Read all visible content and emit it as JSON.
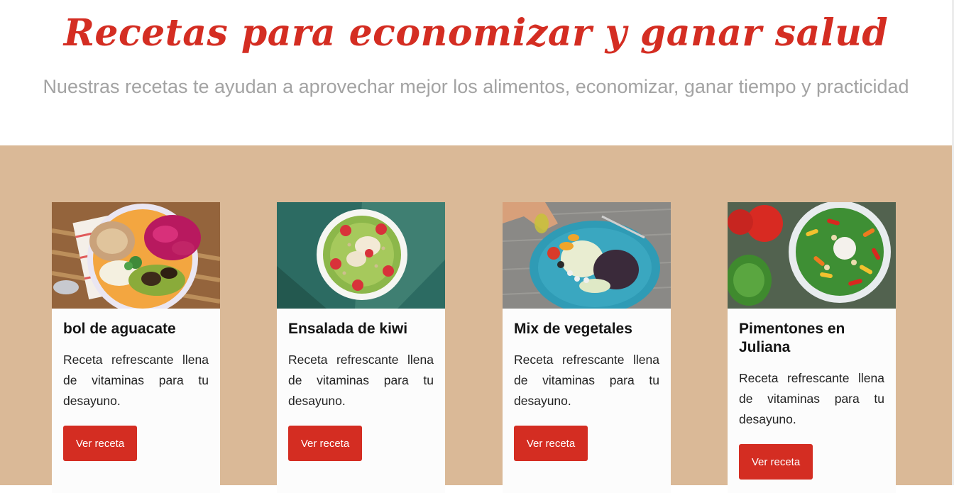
{
  "hero": {
    "title": "Recetas para economizar y ganar salud",
    "subtitle": "Nuestras recetas te ayudan a aprovechar mejor los alimentos, economizar, ganar tiempo y practicidad"
  },
  "colors": {
    "accent": "#d42d22",
    "section_background": "#dab997",
    "card_background": "#fcfcfc",
    "subtitle_gray": "#a3a3a3"
  },
  "cards": [
    {
      "title": "bol de aguacate",
      "description": "Receta refrescante llena de vitaminas para tu desayuno.",
      "button_label": "Ver receta"
    },
    {
      "title": "Ensalada de kiwi",
      "description": "Receta refrescante llena de vitaminas para tu desayuno.",
      "button_label": "Ver receta"
    },
    {
      "title": "Mix de vegetales",
      "description": "Receta refrescante llena de vitaminas para tu desayuno.",
      "button_label": "Ver receta"
    },
    {
      "title": "Pimentones en Juliana",
      "description": "Receta refrescante llena de vitaminas para tu desayuno.",
      "button_label": "Ver receta"
    }
  ]
}
